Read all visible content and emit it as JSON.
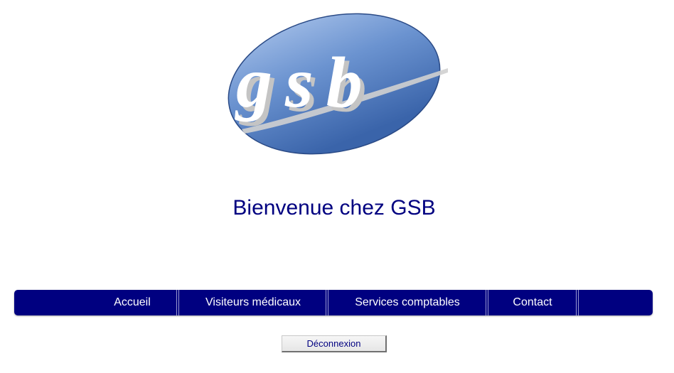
{
  "logo": {
    "text": "gsb",
    "colors": {
      "oval_light": "#9ab6e2",
      "oval_mid": "#5b86c8",
      "oval_dark": "#2a4f90",
      "letters": "#ffffff",
      "shadow": "#c8c8c8"
    }
  },
  "welcome": {
    "title": "Bienvenue chez GSB",
    "color": "#000080"
  },
  "nav": {
    "background": "#000080",
    "items": [
      {
        "label": "Accueil"
      },
      {
        "label": "Visiteurs médicaux"
      },
      {
        "label": "Services comptables"
      },
      {
        "label": "Contact"
      }
    ]
  },
  "logout": {
    "label": "Déconnexion"
  }
}
